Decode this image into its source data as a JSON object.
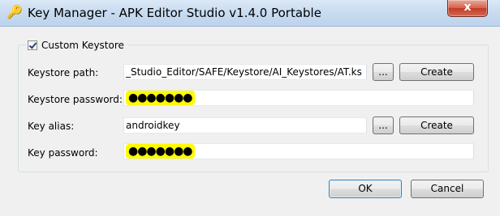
{
  "window": {
    "title": "Key Manager - APK Editor Studio v1.4.0 Portable",
    "close_label": "x"
  },
  "group": {
    "checkbox_label": "Custom Keystore",
    "checked": true
  },
  "form": {
    "keystore_path_label": "Keystore path:",
    "keystore_path_value": "_Studio_Editor/SAFE/Keystore/AI_Keystores/AT.ks",
    "keystore_password_label": "Keystore password:",
    "keystore_password_value": "●●●●●●●",
    "key_alias_label": "Key alias:",
    "key_alias_value": "androidkey",
    "key_password_label": "Key password:",
    "key_password_value": "●●●●●●●"
  },
  "buttons": {
    "browse_label": "...",
    "create_label": "Create",
    "ok_label": "OK",
    "cancel_label": "Cancel"
  },
  "colors": {
    "highlight": "#fffa00",
    "title_bar": "#c9dcf0",
    "close_button": "#c4392a"
  },
  "icons": {
    "window_icon": "key-icon"
  }
}
